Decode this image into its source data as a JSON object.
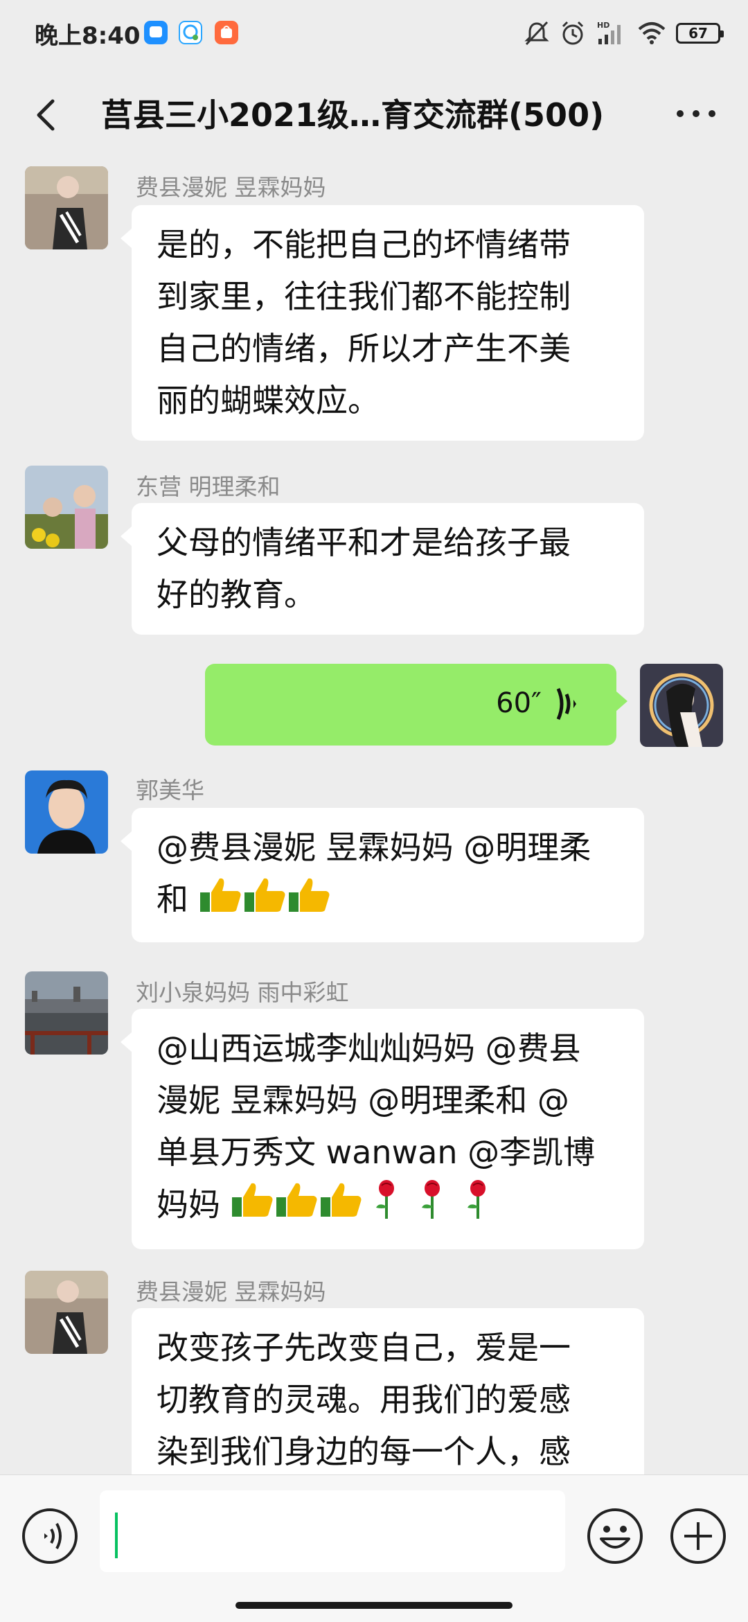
{
  "status_bar": {
    "time": "晚上8:40",
    "battery": "67",
    "icons": [
      "app-blue-icon",
      "app-chat-icon",
      "app-orange-icon",
      "mute-icon",
      "alarm-icon",
      "signal-hd-icon",
      "wifi-icon",
      "battery-icon"
    ]
  },
  "header": {
    "title": "莒县三小2021级…育交流群(500)",
    "back_icon": "back-arrow-icon",
    "more_icon": "more-dots-icon"
  },
  "messages": [
    {
      "sender": "费县漫妮 昱霖妈妈",
      "text": "是的，不能把自己的坏情绪带到家里，往往我们都不能控制自己的情绪，所以才产生不美丽的蝴蝶效应。",
      "lines": [
        "是的，不能把自己的坏情绪带",
        "到家里，往往我们都不能控制",
        "自己的情绪，所以才产生不美",
        "丽的蝴蝶效应。"
      ]
    },
    {
      "sender": "东营  明理柔和",
      "text": "父母的情绪平和才是给孩子最好的教育。",
      "lines": [
        "父母的情绪平和才是给孩子最",
        "好的教育。"
      ]
    },
    {
      "type": "voice",
      "from_self": true,
      "duration": "60″"
    },
    {
      "sender": "郭美华",
      "lines": [
        "@费县漫妮 昱霖妈妈 @明理柔",
        "和 "
      ],
      "emojis": [
        "thumbs-up",
        "thumbs-up",
        "thumbs-up"
      ]
    },
    {
      "sender": "刘小泉妈妈  雨中彩虹",
      "lines": [
        "@山西运城李灿灿妈妈 @费县",
        "漫妮 昱霖妈妈 @明理柔和 @",
        "单县万秀文  wanwan @李凯博",
        "妈妈 "
      ],
      "emojis": [
        "thumbs-up",
        "thumbs-up",
        "thumbs-up",
        "rose",
        "rose",
        "rose"
      ]
    },
    {
      "sender": "费县漫妮 昱霖妈妈",
      "lines": [
        "改变孩子先改变自己，爱是一",
        "切教育的灵魂。用我们的爱感",
        "染到我们身边的每一个人，感"
      ]
    }
  ],
  "input_bar": {
    "voice_icon": "voice-input-icon",
    "emoji_icon": "emoji-icon",
    "plus_icon": "plus-icon"
  },
  "colors": {
    "background": "#ededed",
    "self_bubble": "#95ec69",
    "other_bubble": "#ffffff",
    "accent_caret": "#07c160"
  }
}
